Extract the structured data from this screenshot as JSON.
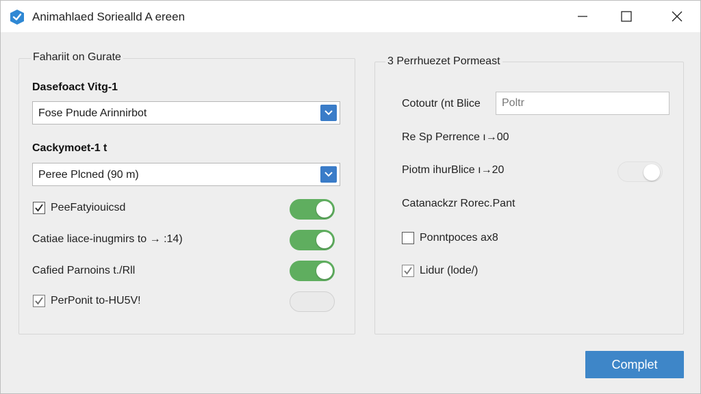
{
  "window": {
    "title": "Animahlaed Soriealld A ereen",
    "accent_color": "#3a7cc8",
    "toggle_on_color": "#5fae5f"
  },
  "left_group": {
    "legend": "Fahariit on Gurate",
    "field1": {
      "label": "Dasefoact Vitg-1",
      "selected": "Fose Pnude Arinnirbot"
    },
    "field2": {
      "label": "Cackymoet-1 t",
      "selected": "Peree Plcned (90 m)"
    },
    "rows": [
      {
        "label": "PeeFatyiouicsd",
        "has_checkbox": true,
        "checked": true,
        "toggle": "on"
      },
      {
        "label": "Catiae liace-inugmirs to → :14)",
        "has_checkbox": false,
        "checked": false,
        "toggle": "on"
      },
      {
        "label": "Cafied Parnoins t./Rll",
        "has_checkbox": false,
        "checked": false,
        "toggle": "on"
      },
      {
        "label": "PerPonit to-HU5V!",
        "has_checkbox": true,
        "checked": true,
        "toggle": "off"
      }
    ]
  },
  "right_group": {
    "legend": "3 Perrhuezet Pormeast",
    "input_label": "Cotoutr (nt Blice",
    "input_placeholder": "Poltr",
    "line1": "Re Sp Perrence ı→00",
    "line2": "Piotm ihurBlice ı→20",
    "line2_toggle": "off",
    "line3": "Catanackzr Rorec.Pant",
    "check1": {
      "label": "Ponntpoces ax8",
      "checked": false
    },
    "check2": {
      "label": "Lidur (lode/)",
      "checked": true
    }
  },
  "footer": {
    "primary_label": "Complet"
  }
}
